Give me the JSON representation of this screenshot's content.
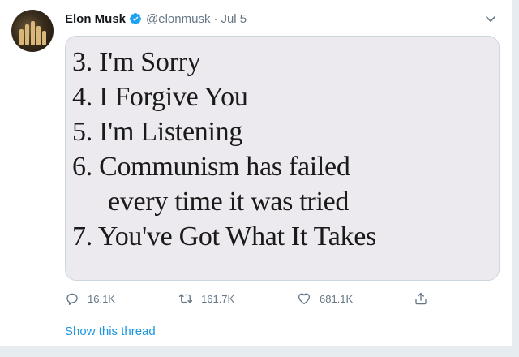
{
  "tweet": {
    "author": {
      "name": "Elon Musk",
      "handle": "@elonmusk",
      "separator": "·",
      "date": "Jul 5"
    },
    "image_text": [
      "3. I'm Sorry",
      "4. I Forgive You",
      "5. I'm Listening",
      "6. Communism has failed",
      "every time it was tried",
      "7. You've Got What It Takes"
    ],
    "actions": {
      "reply": {
        "icon": "reply-icon",
        "count": "16.1K"
      },
      "retweet": {
        "icon": "retweet-icon",
        "count": "161.7K"
      },
      "like": {
        "icon": "heart-icon",
        "count": "681.1K"
      },
      "share": {
        "icon": "share-icon"
      }
    },
    "show_thread_label": "Show this thread"
  },
  "colors": {
    "link": "#1b95e0",
    "muted": "#657786",
    "verified": "#1da1f2",
    "text": "#14171a"
  }
}
